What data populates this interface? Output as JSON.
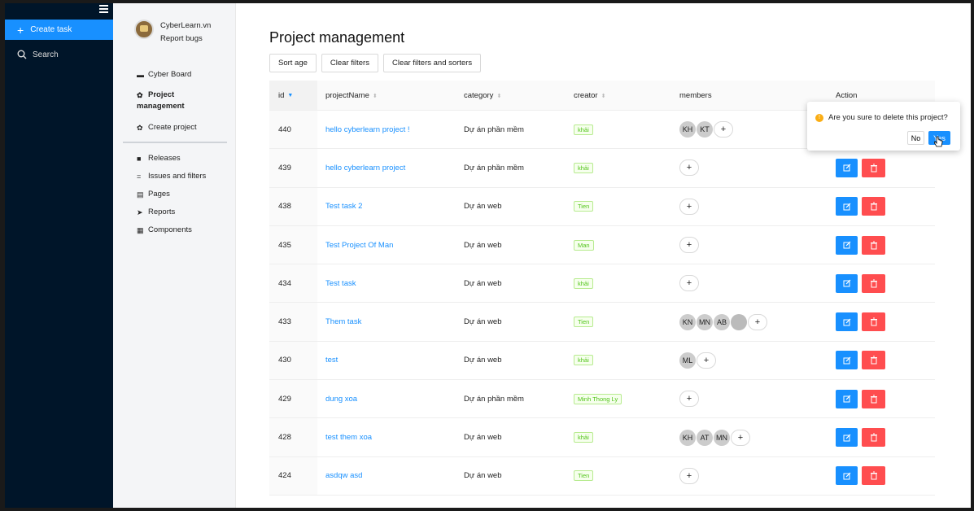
{
  "nav": {
    "create_task": "Create task",
    "search": "Search"
  },
  "brand": {
    "name": "CyberLearn.vn",
    "sub": "Report bugs"
  },
  "menu": {
    "cyber_board": "Cyber Board",
    "project_management_1": "Project",
    "project_management_2": "management",
    "create_project": "Create project",
    "releases": "Releases",
    "issues": "Issues and filters",
    "pages": "Pages",
    "reports": "Reports",
    "components": "Components"
  },
  "page": {
    "title": "Project management",
    "buttons": [
      "Sort age",
      "Clear filters",
      "Clear filters and sorters"
    ]
  },
  "table": {
    "headers": {
      "id": "id",
      "projectName": "projectName",
      "category": "category",
      "creator": "creator",
      "members": "members",
      "action": "Action"
    },
    "rows": [
      {
        "id": "440",
        "name": "hello cyberlearn project !",
        "category": "Dự án phần mềm",
        "creator": "khải",
        "members": [
          "KH",
          "KT"
        ]
      },
      {
        "id": "439",
        "name": "hello cyberlearn project",
        "category": "Dự án phần mềm",
        "creator": "khải",
        "members": []
      },
      {
        "id": "438",
        "name": "Test task 2",
        "category": "Dự án web",
        "creator": "Tien",
        "members": []
      },
      {
        "id": "435",
        "name": "Test Project Of Man",
        "category": "Dự án web",
        "creator": "Man",
        "members": []
      },
      {
        "id": "434",
        "name": "Test task",
        "category": "Dự án web",
        "creator": "khải",
        "members": []
      },
      {
        "id": "433",
        "name": "Them task",
        "category": "Dự án web",
        "creator": "Tien",
        "members": [
          "KN",
          "MN",
          "AB",
          "..."
        ]
      },
      {
        "id": "430",
        "name": "test",
        "category": "Dự án web",
        "creator": "khải",
        "members": [
          "ML"
        ]
      },
      {
        "id": "429",
        "name": "dung xoa",
        "category": "Dự án phần mềm",
        "creator": "Minh Thong Ly",
        "members": []
      },
      {
        "id": "428",
        "name": "test them xoa",
        "category": "Dự án web",
        "creator": "khải",
        "members": [
          "KH",
          "AT",
          "MN"
        ]
      },
      {
        "id": "424",
        "name": "asdqw asd",
        "category": "Dự án web",
        "creator": "Tien",
        "members": []
      }
    ]
  },
  "popconfirm": {
    "message": "Are you sure to delete this project?",
    "no": "No",
    "yes": "Yes"
  },
  "colors": {
    "primary": "#1890ff",
    "danger": "#ff4d4f",
    "sidebar": "#001529",
    "tag_green": "#52c41a"
  }
}
